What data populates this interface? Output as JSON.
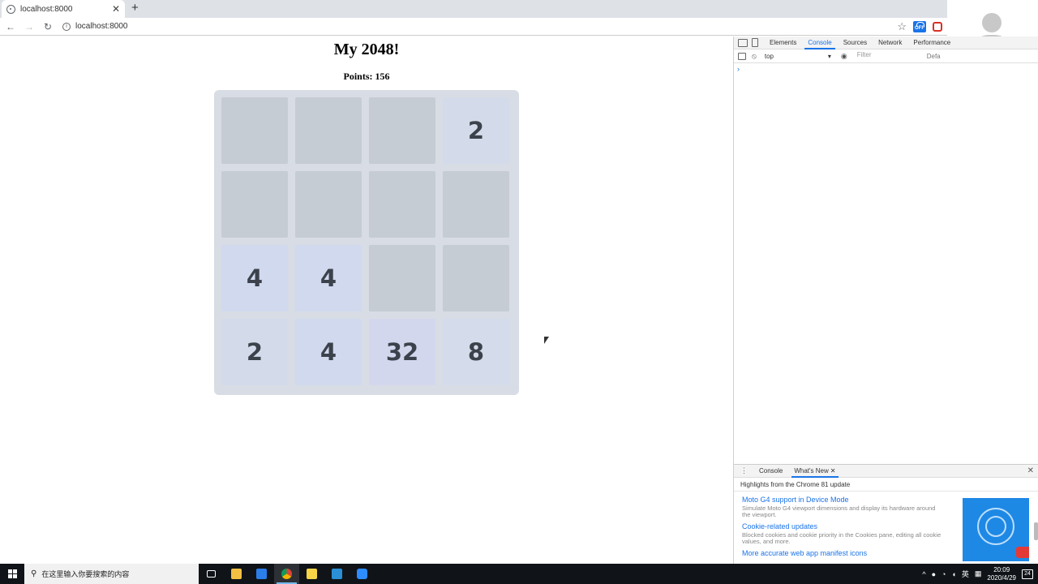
{
  "browser": {
    "tab_title": "localhost:8000",
    "tab_close": "✕",
    "new_tab": "+",
    "url": "localhost:8000",
    "back": "←",
    "forward": "→",
    "reload": "↻",
    "bookmark": "☆",
    "extension_label": "OFF"
  },
  "game": {
    "title": "My 2048!",
    "points_label": "Points: 156",
    "board": [
      [
        "",
        "",
        "",
        "2"
      ],
      [
        "",
        "",
        "",
        ""
      ],
      [
        "4",
        "4",
        "",
        ""
      ],
      [
        "2",
        "4",
        "32",
        "8"
      ]
    ]
  },
  "devtools": {
    "tabs": [
      "Elements",
      "Console",
      "Sources",
      "Network",
      "Performance"
    ],
    "active_tab": "Console",
    "context": "top",
    "context_arrow": "▾",
    "filter_placeholder": "Filter",
    "levels": "Defa",
    "prompt": "›",
    "drawer": {
      "tabs": [
        "Console",
        "What's New"
      ],
      "active_tab": "What's New",
      "tab_close": "✕",
      "close": "✕",
      "dots": "⋮",
      "highlights": "Highlights from the Chrome 81 update",
      "items": [
        {
          "title": "Moto G4 support in Device Mode",
          "desc": "Simulate Moto G4 viewport dimensions and display its hardware around the viewport."
        },
        {
          "title": "Cookie-related updates",
          "desc": "Blocked cookies and cookie priority in the Cookies pane, editing all cookie values, and more."
        },
        {
          "title": "More accurate web app manifest icons",
          "desc": ""
        }
      ]
    }
  },
  "taskbar": {
    "search_placeholder": "在这里输入你要搜索的内容",
    "tray_ime": "英",
    "time": "20:09",
    "date": "2020/4/29",
    "notifications": "24"
  }
}
